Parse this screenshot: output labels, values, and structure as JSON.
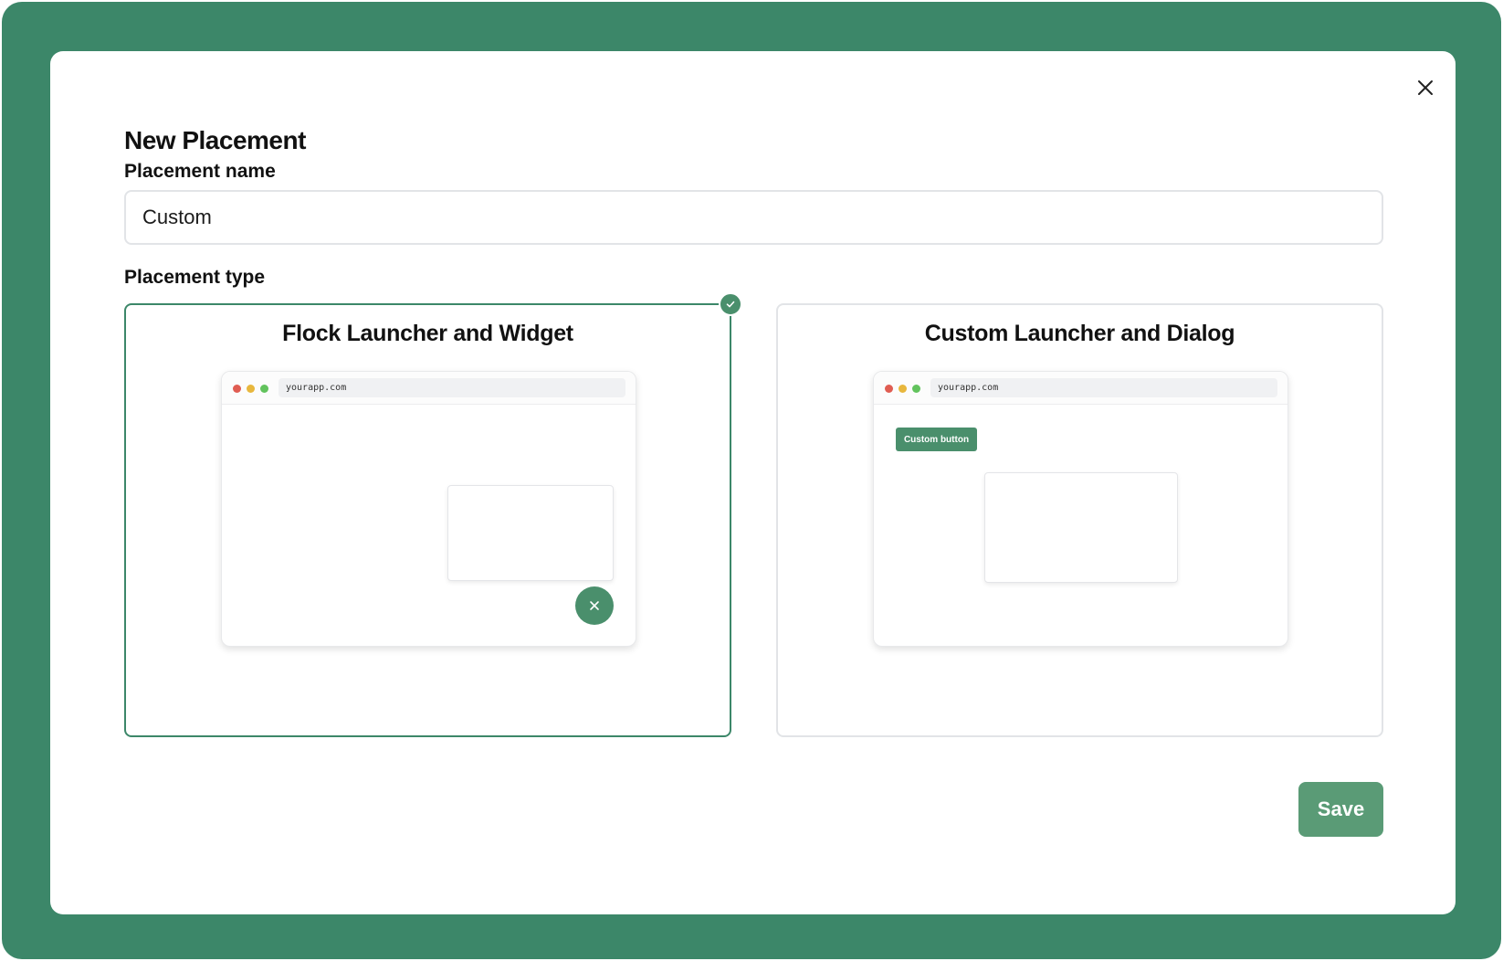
{
  "modal": {
    "title": "New Placement",
    "close_icon": "close-icon"
  },
  "placement_name": {
    "label": "Placement name",
    "value": "Custom"
  },
  "placement_type": {
    "label": "Placement type",
    "selected": "flock",
    "options": [
      {
        "id": "flock",
        "title": "Flock Launcher and Widget",
        "url": "yourapp.com",
        "launcher_icon": "close-icon"
      },
      {
        "id": "custom",
        "title": "Custom Launcher and Dialog",
        "url": "yourapp.com",
        "custom_button_label": "Custom button"
      }
    ]
  },
  "actions": {
    "save_label": "Save"
  },
  "colors": {
    "brand": "#3c8769",
    "accent": "#4a8f6c",
    "save_button": "#5a9b76",
    "dot_red": "#e05d52",
    "dot_yellow": "#e8b73d",
    "dot_green": "#62c35d"
  }
}
